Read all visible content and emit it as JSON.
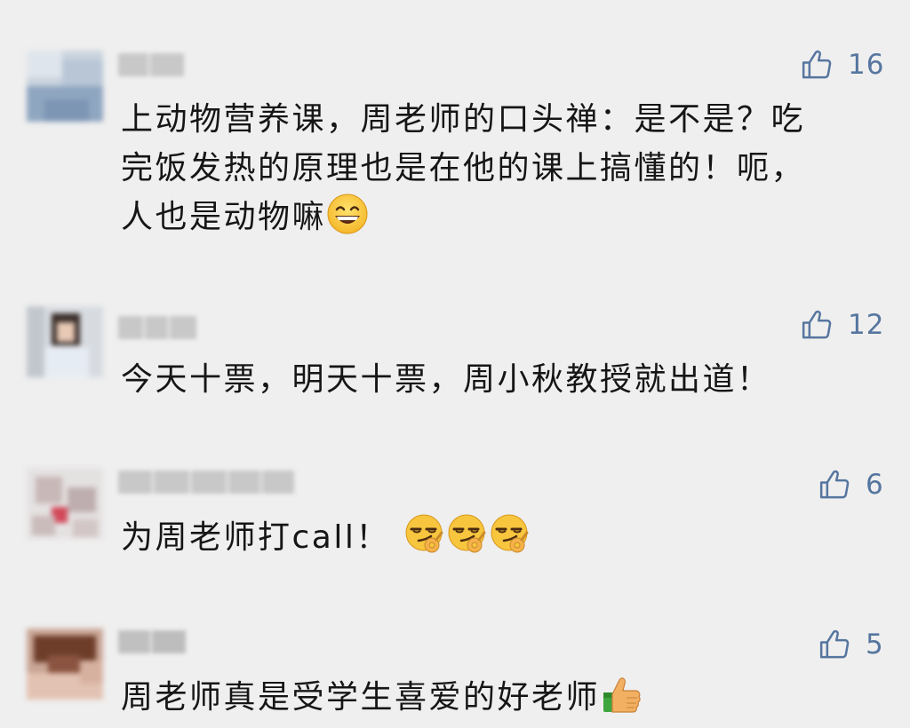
{
  "comments": [
    {
      "likes": "16",
      "lines": [
        "上动物营养课，周老师的口头禅：是不是？吃",
        "完饭发热的原理也是在他的课上搞懂的！呃，",
        "人也是动物嘛"
      ],
      "emojis": [
        "grinning-face"
      ]
    },
    {
      "likes": "12",
      "lines": [
        "今天十票，明天十票，周小秋教授就出道！"
      ],
      "emojis": []
    },
    {
      "likes": "6",
      "lines": [
        "为周老师打call！"
      ],
      "emojis": [
        "smirk-ok-hand",
        "smirk-ok-hand",
        "smirk-ok-hand"
      ]
    },
    {
      "likes": "5",
      "lines": [
        "周老师真是受学生喜爱的好老师"
      ],
      "emojis": [
        "thumbs-up"
      ]
    }
  ],
  "colors": {
    "background": "#efefef",
    "like_accent": "#56769f",
    "text": "#161616"
  },
  "icons": {
    "like": "thumbs-up-outline-icon"
  }
}
